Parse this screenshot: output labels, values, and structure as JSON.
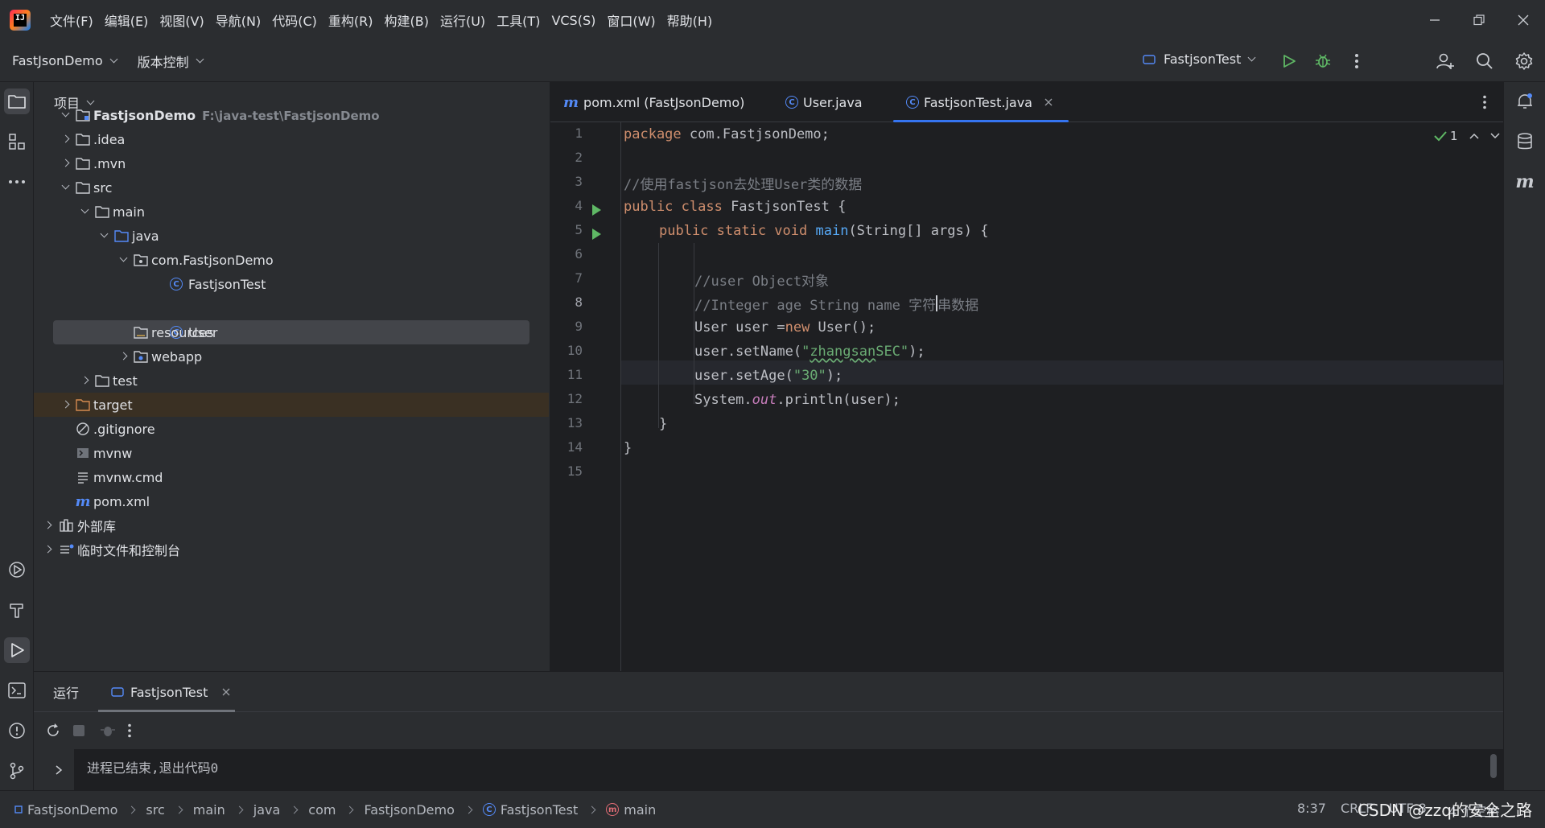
{
  "menu": [
    "文件(F)",
    "编辑(E)",
    "视图(V)",
    "导航(N)",
    "代码(C)",
    "重构(R)",
    "构建(B)",
    "运行(U)",
    "工具(T)",
    "VCS(S)",
    "窗口(W)",
    "帮助(H)"
  ],
  "toolbar": {
    "project_name": "FastJsonDemo",
    "vcs_label": "版本控制",
    "run_config": "FastjsonTest"
  },
  "project_panel": {
    "title": "项目",
    "tree": [
      {
        "label": "FastjsonDemo",
        "hint": "F:\\java-test\\FastjsonDemo"
      },
      {
        "label": ".idea"
      },
      {
        "label": ".mvn"
      },
      {
        "label": "src"
      },
      {
        "label": "main"
      },
      {
        "label": "java"
      },
      {
        "label": "com.FastjsonDemo"
      },
      {
        "label": "FastjsonTest"
      },
      {
        "label": "User"
      },
      {
        "label": "resources"
      },
      {
        "label": "webapp"
      },
      {
        "label": "test"
      },
      {
        "label": "target"
      },
      {
        "label": ".gitignore"
      },
      {
        "label": "mvnw"
      },
      {
        "label": "mvnw.cmd"
      },
      {
        "label": "pom.xml"
      },
      {
        "label": "外部库"
      },
      {
        "label": "临时文件和控制台"
      }
    ]
  },
  "editor": {
    "tabs": [
      {
        "label": "pom.xml (FastJsonDemo)"
      },
      {
        "label": "User.java"
      },
      {
        "label": "FastjsonTest.java"
      }
    ],
    "inspection_count": "1",
    "current_line": 8,
    "line_numbers": [
      "1",
      "2",
      "3",
      "4",
      "5",
      "6",
      "7",
      "8",
      "9",
      "10",
      "11",
      "12",
      "13",
      "14",
      "15"
    ],
    "code": {
      "l1_kw": "package",
      "l1_rest": " com.FastjsonDemo;",
      "l3": "//使用fastjson去处理User类的数据",
      "l4_kw": "public class",
      "l4_rest": " FastjsonTest {",
      "l5_kw": "public static void",
      "l5_fn": "main",
      "l5_rest": "(String[] args) {",
      "l7": "//user Object对象",
      "l8_a": "//Integer age String name 字符",
      "l8_b": "串数据",
      "l9_a": "User user =",
      "l9_kw": "new",
      "l9_b": " User();",
      "l10_a": "user.setName(",
      "l10_q1": "\"",
      "l10_sq": "zhangsan",
      "l10_s": "SEC\"",
      "l10_b": ");",
      "l11_a": "user.setAge(",
      "l11_s": "\"30\"",
      "l11_b": ");",
      "l12_a": "System.",
      "l12_it": "out",
      "l12_b": ".println(user);",
      "l13": "}",
      "l14": "}"
    }
  },
  "run_panel": {
    "title": "运行",
    "tab": "FastjsonTest",
    "output": "进程已结束,退出代码0"
  },
  "statusbar": {
    "breadcrumbs": [
      "FastjsonDemo",
      "src",
      "main",
      "java",
      "com",
      "FastjsonDemo",
      "FastjsonTest",
      "main"
    ],
    "position": "8:37",
    "line_sep": "CRLF",
    "encoding": "UTF-8",
    "indent": "4 个空格"
  },
  "watermark": "CSDN @zzq的安全之路",
  "colors": {
    "accent": "#3574f0",
    "run_green": "#5fb865",
    "keyword": "#cf8e6d",
    "string": "#6aab73",
    "comment": "#7a7e85",
    "function": "#56a8f5"
  }
}
